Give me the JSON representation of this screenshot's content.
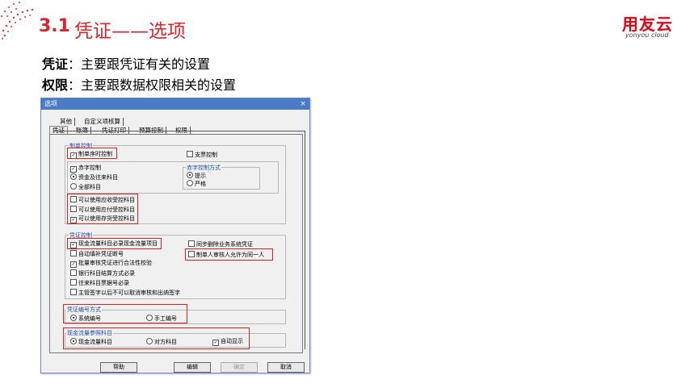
{
  "slide": {
    "section_number": "3.1",
    "title": "凭证——选项",
    "brand": "用友云",
    "brand_sub": "yonyou cloud",
    "bullets": [
      {
        "term": "凭证",
        "desc": "：主要跟凭证有关的设置"
      },
      {
        "term": "权限",
        "desc": "：主要跟数据权限相关的设置"
      }
    ]
  },
  "dialog": {
    "title": "选项",
    "close": "×",
    "tabs_row1": [
      "其他",
      "自定义项核算"
    ],
    "tabs_row2": [
      "凭证",
      "账簿",
      "凭证打印",
      "预算控制",
      "权限"
    ],
    "groups": {
      "zhidan": {
        "label": "制单控制",
        "serial": "制单序时控制",
        "check_control": "支票控制",
        "red_control": "赤字控制",
        "red_opt1": "资金及往来科目",
        "red_opt2": "全部科目",
        "red_mode_label": "赤字控制方式",
        "red_mode1": "提示",
        "red_mode2": "严格",
        "use_receivable": "可以使用应收受控科目",
        "use_payable": "可以使用应付受控科目",
        "use_inventory": "可以使用存货受控科目"
      },
      "pingzheng": {
        "label": "凭证控制",
        "cashflow": "现金流量科目必录现金流量项目",
        "sync_delete": "同步删除业务系统凭证",
        "auto_fill": "自动填补凭证断号",
        "same_person": "制单人审核人允许为同一人",
        "batch_check": "批量审核凭证进行合法性校验",
        "bank_method": "银行科目结算方式必录",
        "ticket_no": "往来科目票据号必录",
        "supervisor": "主管签字以后不可以取消审核和出纳签字"
      },
      "numbering": {
        "label": "凭证编号方式",
        "system": "系统编号",
        "manual": "手工编号"
      },
      "cashflow_ref": {
        "label": "现金流量参照科目",
        "cash_subject": "现金流量科目",
        "counter_subject": "对方科目",
        "auto_show": "自动显示"
      }
    },
    "buttons": {
      "help": "帮助",
      "edit": "编辑",
      "ok": "确定",
      "cancel": "取消"
    }
  },
  "colors": {
    "accent": "#d9252e",
    "highlight_box": "#e02020",
    "titlebar": "#4a7bc4"
  }
}
